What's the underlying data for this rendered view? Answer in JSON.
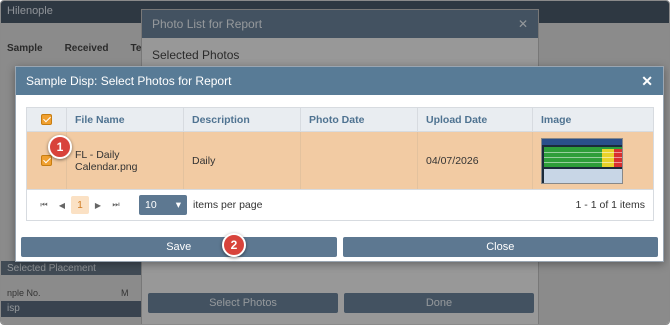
{
  "background": {
    "topbar_text": "Hilenople",
    "tabs": [
      "Sample",
      "Received",
      "Tes"
    ],
    "left_band_text": "Selected Placement",
    "left_label": "nple No.",
    "left_label2": "M",
    "left_band2_text": "isp",
    "dialog_title": "Photo List for Report",
    "dialog_subtitle": "Selected Photos",
    "select_photos_label": "Select Photos",
    "done_label": "Done"
  },
  "modal": {
    "title": "Sample Disp: Select Photos for Report",
    "columns": [
      "File Name",
      "Description",
      "Photo Date",
      "Upload Date",
      "Image"
    ],
    "rows": [
      {
        "checked": true,
        "file_name": "FL - Daily Calendar.png",
        "description": "Daily",
        "photo_date": "",
        "upload_date": "04/07/2026"
      }
    ],
    "pager": {
      "current_page": "1",
      "per_page": "10",
      "per_page_label": "items per page",
      "info": "1 - 1 of 1 items"
    },
    "save_label": "Save",
    "close_label": "Close"
  },
  "callouts": [
    "1",
    "2"
  ],
  "colors": {
    "header_blue": "#587b96",
    "row_highlight": "#f2cba3",
    "checkbox_orange": "#f0a030",
    "callout_red": "#d8433b"
  }
}
